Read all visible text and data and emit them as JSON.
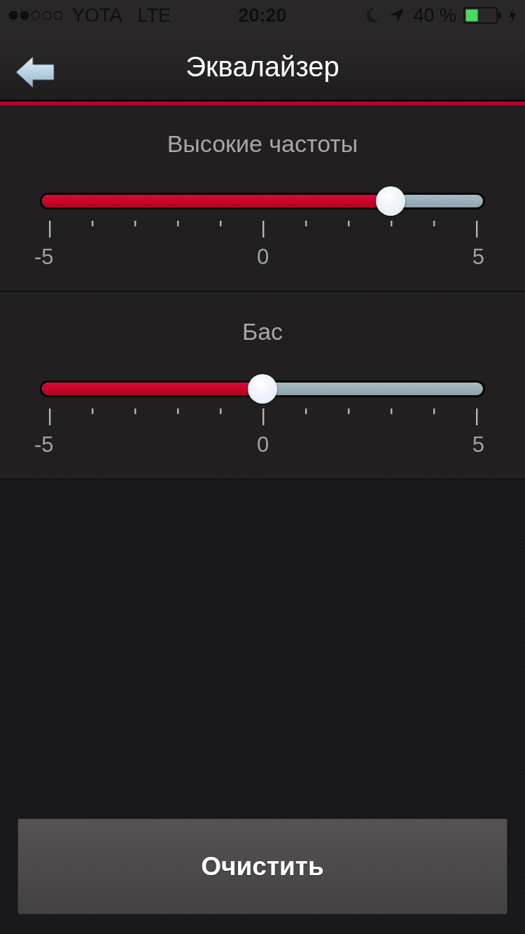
{
  "status_bar": {
    "carrier": "YOTA",
    "network": "LTE",
    "time": "20:20",
    "battery_percent": "40 %"
  },
  "nav_bar": {
    "title": "Эквалайзер"
  },
  "sliders": [
    {
      "label": "Высокие частоты",
      "level": 0.8,
      "scale_labels": [
        "-5",
        "0",
        "5"
      ]
    },
    {
      "label": "Бас",
      "level": 0.5,
      "scale_labels": [
        "-5",
        "0",
        "5"
      ]
    }
  ],
  "buttons": [
    {
      "label": "Очистить"
    }
  ]
}
